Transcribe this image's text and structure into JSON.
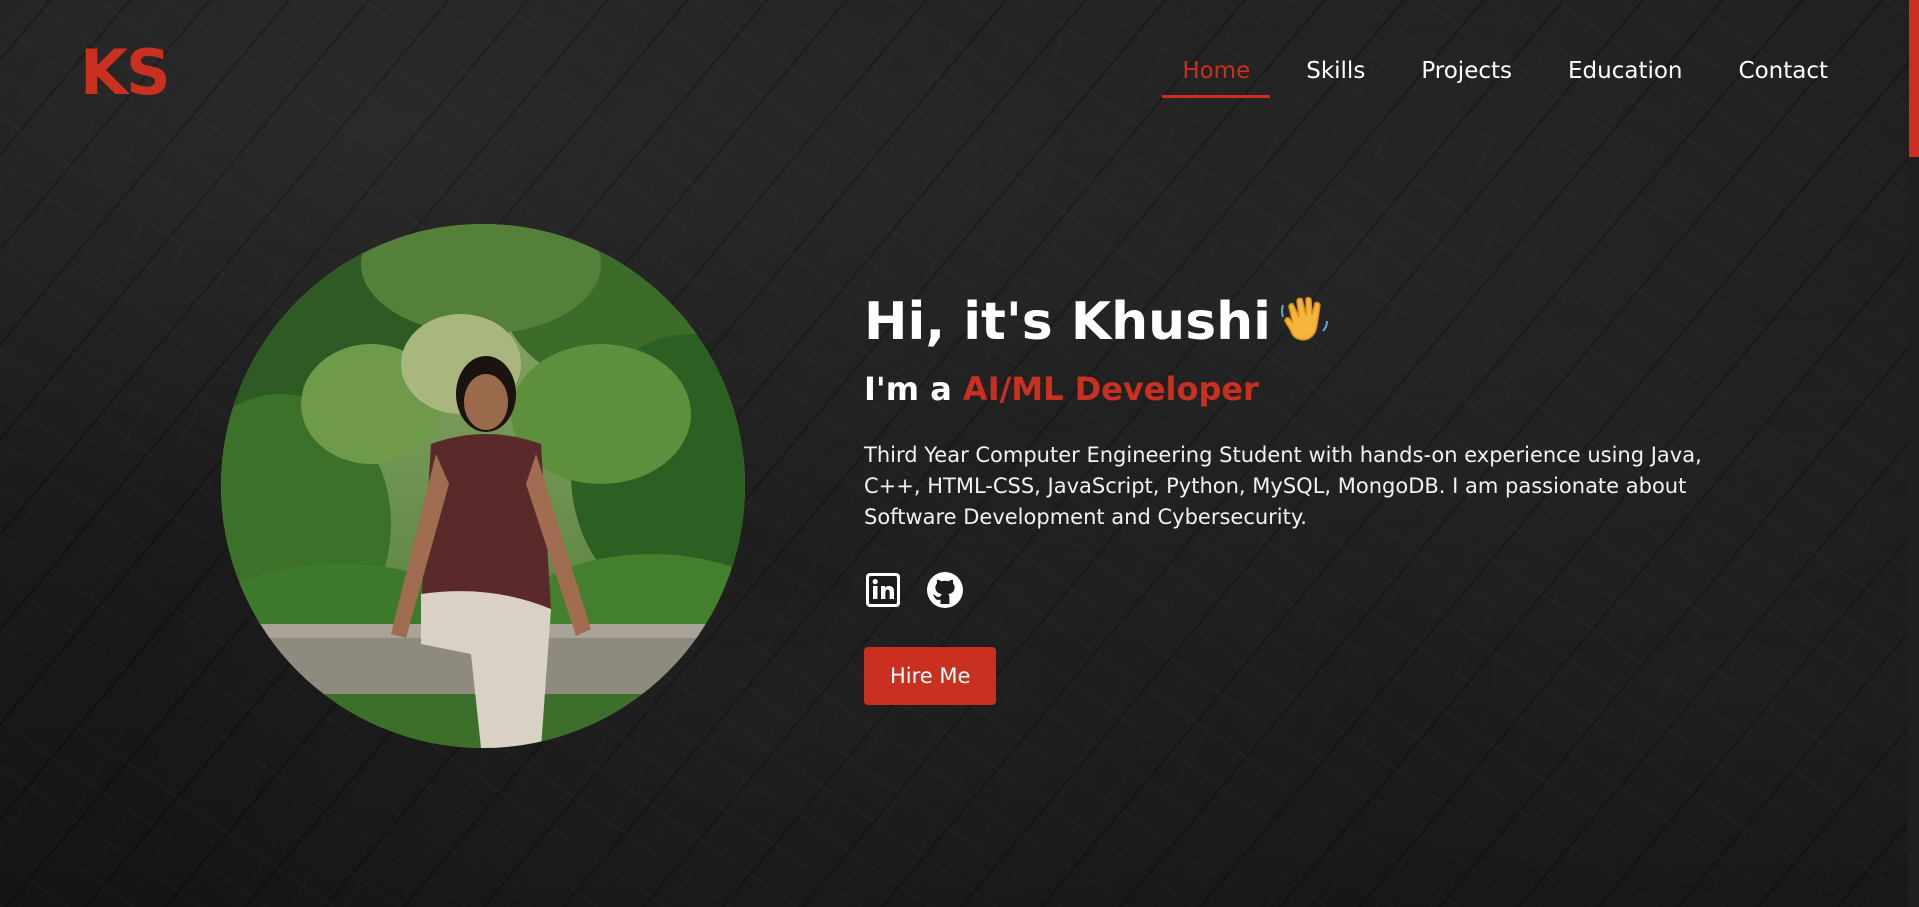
{
  "header": {
    "logo": "KS",
    "nav": [
      {
        "label": "Home",
        "active": true
      },
      {
        "label": "Skills",
        "active": false
      },
      {
        "label": "Projects",
        "active": false
      },
      {
        "label": "Education",
        "active": false
      },
      {
        "label": "Contact",
        "active": false
      }
    ]
  },
  "hero": {
    "greeting": "Hi, it's Khushi",
    "greeting_emoji": "waving-hand-icon",
    "role_prefix": "I'm a ",
    "role": "AI/ML Developer",
    "description": "Third Year Computer Engineering Student with hands-on experience using Java, C++, HTML-CSS, JavaScript, Python, MySQL, MongoDB. I am passionate about Software Development and Cybersecurity.",
    "socials": [
      {
        "icon": "linkedin-icon"
      },
      {
        "icon": "github-icon"
      }
    ],
    "cta_label": "Hire Me",
    "photo_icon": "profile-photo"
  },
  "colors": {
    "accent": "#c9301f",
    "background": "#1b1b1b",
    "text": "#ffffff"
  }
}
